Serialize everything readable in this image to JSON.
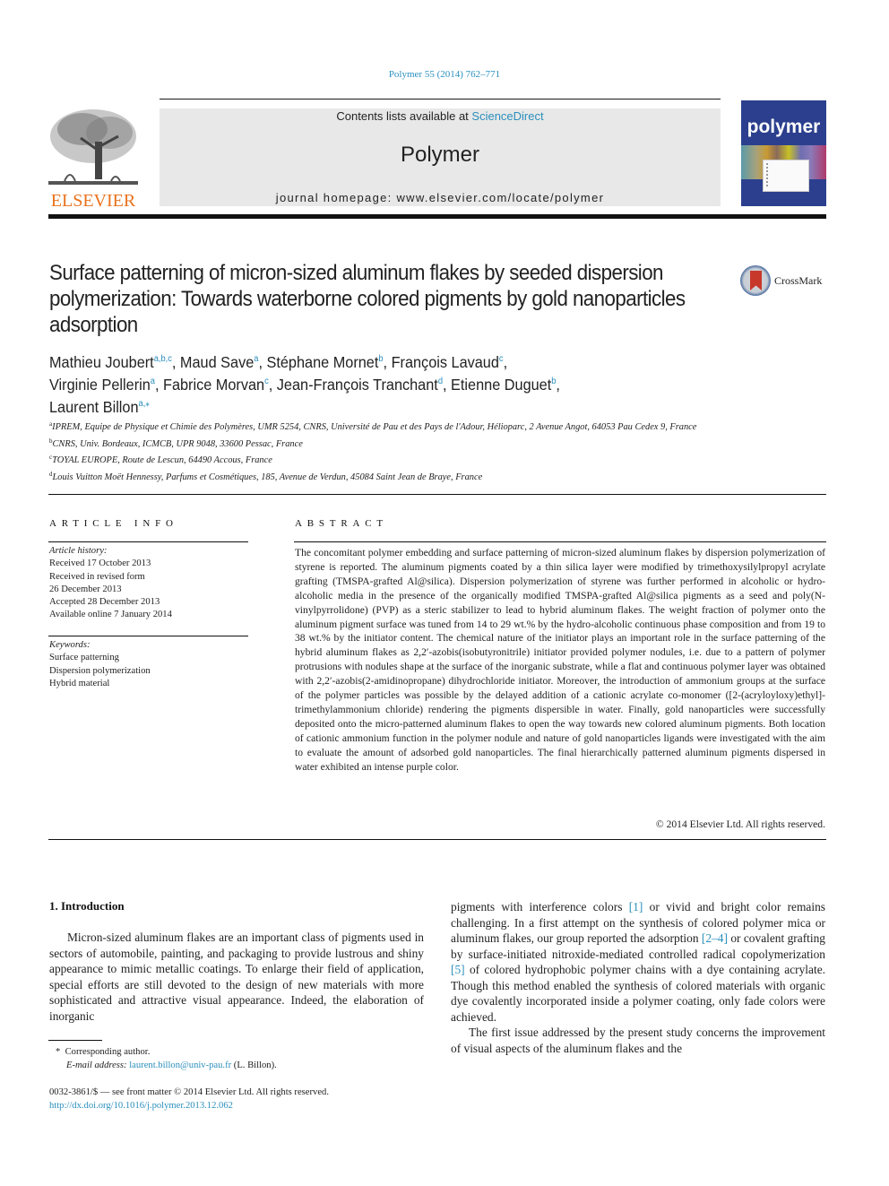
{
  "header": {
    "journal_ref": "Polymer 55 (2014) 762–771",
    "publisher_logo_text": "ELSEVIER",
    "contents_prefix": "Contents lists available at ",
    "contents_link": "ScienceDirect",
    "journal_name": "Polymer",
    "homepage_label": "journal homepage: www.elsevier.com/locate/polymer",
    "cover_title": "polymer",
    "crossmark_label": "CrossMark"
  },
  "colors": {
    "link": "#2a8fbd",
    "elsevier_orange": "#e9711c",
    "cover_blue": "#2b3f8e",
    "masthead_gray": "#e8e8e8"
  },
  "article": {
    "title": "Surface patterning of micron-sized aluminum flakes by seeded dispersion polymerization: Towards waterborne colored pigments by gold nanoparticles adsorption",
    "authors": [
      {
        "name": "Mathieu Joubert",
        "aff": "a,b,c",
        "sep": ", "
      },
      {
        "name": "Maud Save",
        "aff": "a",
        "sep": ", "
      },
      {
        "name": "Stéphane Mornet",
        "aff": "b",
        "sep": ", "
      },
      {
        "name": "François Lavaud",
        "aff": "c",
        "sep": ","
      },
      {
        "name": "Virginie Pellerin",
        "aff": "a",
        "sep": ", "
      },
      {
        "name": "Fabrice Morvan",
        "aff": "c",
        "sep": ", "
      },
      {
        "name": "Jean-François Tranchant",
        "aff": "d",
        "sep": ", "
      },
      {
        "name": "Etienne Duguet",
        "aff": "b",
        "sep": ","
      },
      {
        "name": "Laurent Billon",
        "aff": "a,⁎",
        "sep": ""
      }
    ],
    "affiliations": [
      {
        "key": "a",
        "text": "IPREM, Equipe de Physique et Chimie des Polymères, UMR 5254, CNRS, Université de Pau et des Pays de l'Adour, Hélioparc, 2 Avenue Angot, 64053 Pau Cedex 9, France"
      },
      {
        "key": "b",
        "text": "CNRS, Univ. Bordeaux, ICMCB, UPR 9048, 33600 Pessac, France"
      },
      {
        "key": "c",
        "text": "TOYAL EUROPE, Route de Lescun, 64490 Accous, France"
      },
      {
        "key": "d",
        "text": "Louis Vuitton Moët Hennessy, Parfums et Cosmétiques, 185, Avenue de Verdun, 45084 Saint Jean de Braye, France"
      }
    ]
  },
  "article_info": {
    "heading": "ARTICLE INFO",
    "history_label": "Article history:",
    "history": [
      "Received 17 October 2013",
      "Received in revised form",
      "26 December 2013",
      "Accepted 28 December 2013",
      "Available online 7 January 2014"
    ],
    "keywords_label": "Keywords:",
    "keywords": [
      "Surface patterning",
      "Dispersion polymerization",
      "Hybrid material"
    ]
  },
  "abstract": {
    "heading": "ABSTRACT",
    "text": "The concomitant polymer embedding and surface patterning of micron-sized aluminum flakes by dispersion polymerization of styrene is reported. The aluminum pigments coated by a thin silica layer were modified by trimethoxysilylpropyl acrylate grafting (TMSPA-grafted Al@silica). Dispersion polymerization of styrene was further performed in alcoholic or hydro-alcoholic media in the presence of the organically modified TMSPA-grafted Al@silica pigments as a seed and poly(N-vinylpyrrolidone) (PVP) as a steric stabilizer to lead to hybrid aluminum flakes. The weight fraction of polymer onto the aluminum pigment surface was tuned from 14 to 29 wt.% by the hydro-alcoholic continuous phase composition and from 19 to 38 wt.% by the initiator content. The chemical nature of the initiator plays an important role in the surface patterning of the hybrid aluminum flakes as 2,2′-azobis(isobutyronitrile) initiator provided polymer nodules, i.e. due to a pattern of polymer protrusions with nodules shape at the surface of the inorganic substrate, while a flat and continuous polymer layer was obtained with 2,2′-azobis(2-amidinopropane) dihydrochloride initiator. Moreover, the introduction of ammonium groups at the surface of the polymer particles was possible by the delayed addition of a cationic acrylate co-monomer ([2-(acryloyloxy)ethyl]-trimethylammonium chloride) rendering the pigments dispersible in water. Finally, gold nanoparticles were successfully deposited onto the micro-patterned aluminum flakes to open the way towards new colored aluminum pigments. Both location of cationic ammonium function in the polymer nodule and nature of gold nanoparticles ligands were investigated with the aim to evaluate the amount of adsorbed gold nanoparticles. The final hierarchically patterned aluminum pigments dispersed in water exhibited an intense purple color.",
    "copyright": "© 2014 Elsevier Ltd. All rights reserved."
  },
  "introduction": {
    "heading": "1.  Introduction",
    "left_para": "Micron-sized aluminum flakes are an important class of pigments used in sectors of automobile, painting, and packaging to provide lustrous and shiny appearance to mimic metallic coatings. To enlarge their field of application, special efforts are still devoted to the design of new materials with more sophisticated and attractive visual appearance. Indeed, the elaboration of inorganic",
    "right_segments": [
      {
        "t": "pigments with interference colors "
      },
      {
        "t": "[1]",
        "ref": true
      },
      {
        "t": " or vivid and bright color remains challenging. In a first attempt on the synthesis of colored polymer mica or aluminum flakes, our group reported the adsorption "
      },
      {
        "t": "[2–4]",
        "ref": true
      },
      {
        "t": " or covalent grafting by surface-initiated nitroxide-mediated controlled radical copolymerization "
      },
      {
        "t": "[5]",
        "ref": true
      },
      {
        "t": " of colored hydrophobic polymer chains with a dye containing acrylate. Though this method enabled the synthesis of colored materials with organic dye covalently incorporated inside a polymer coating, only fade colors were achieved."
      }
    ],
    "right_para2": "The first issue addressed by the present study concerns the improvement of visual aspects of the aluminum flakes and the"
  },
  "footnote": {
    "marker": "*",
    "corresponding": "Corresponding author.",
    "email_label": "E-mail address:",
    "email": "laurent.billon@univ-pau.fr",
    "email_suffix": " (L. Billon).",
    "issn": "0032-3861/$ — see front matter © 2014 Elsevier Ltd. All rights reserved.",
    "doi": "http://dx.doi.org/10.1016/j.polymer.2013.12.062"
  }
}
